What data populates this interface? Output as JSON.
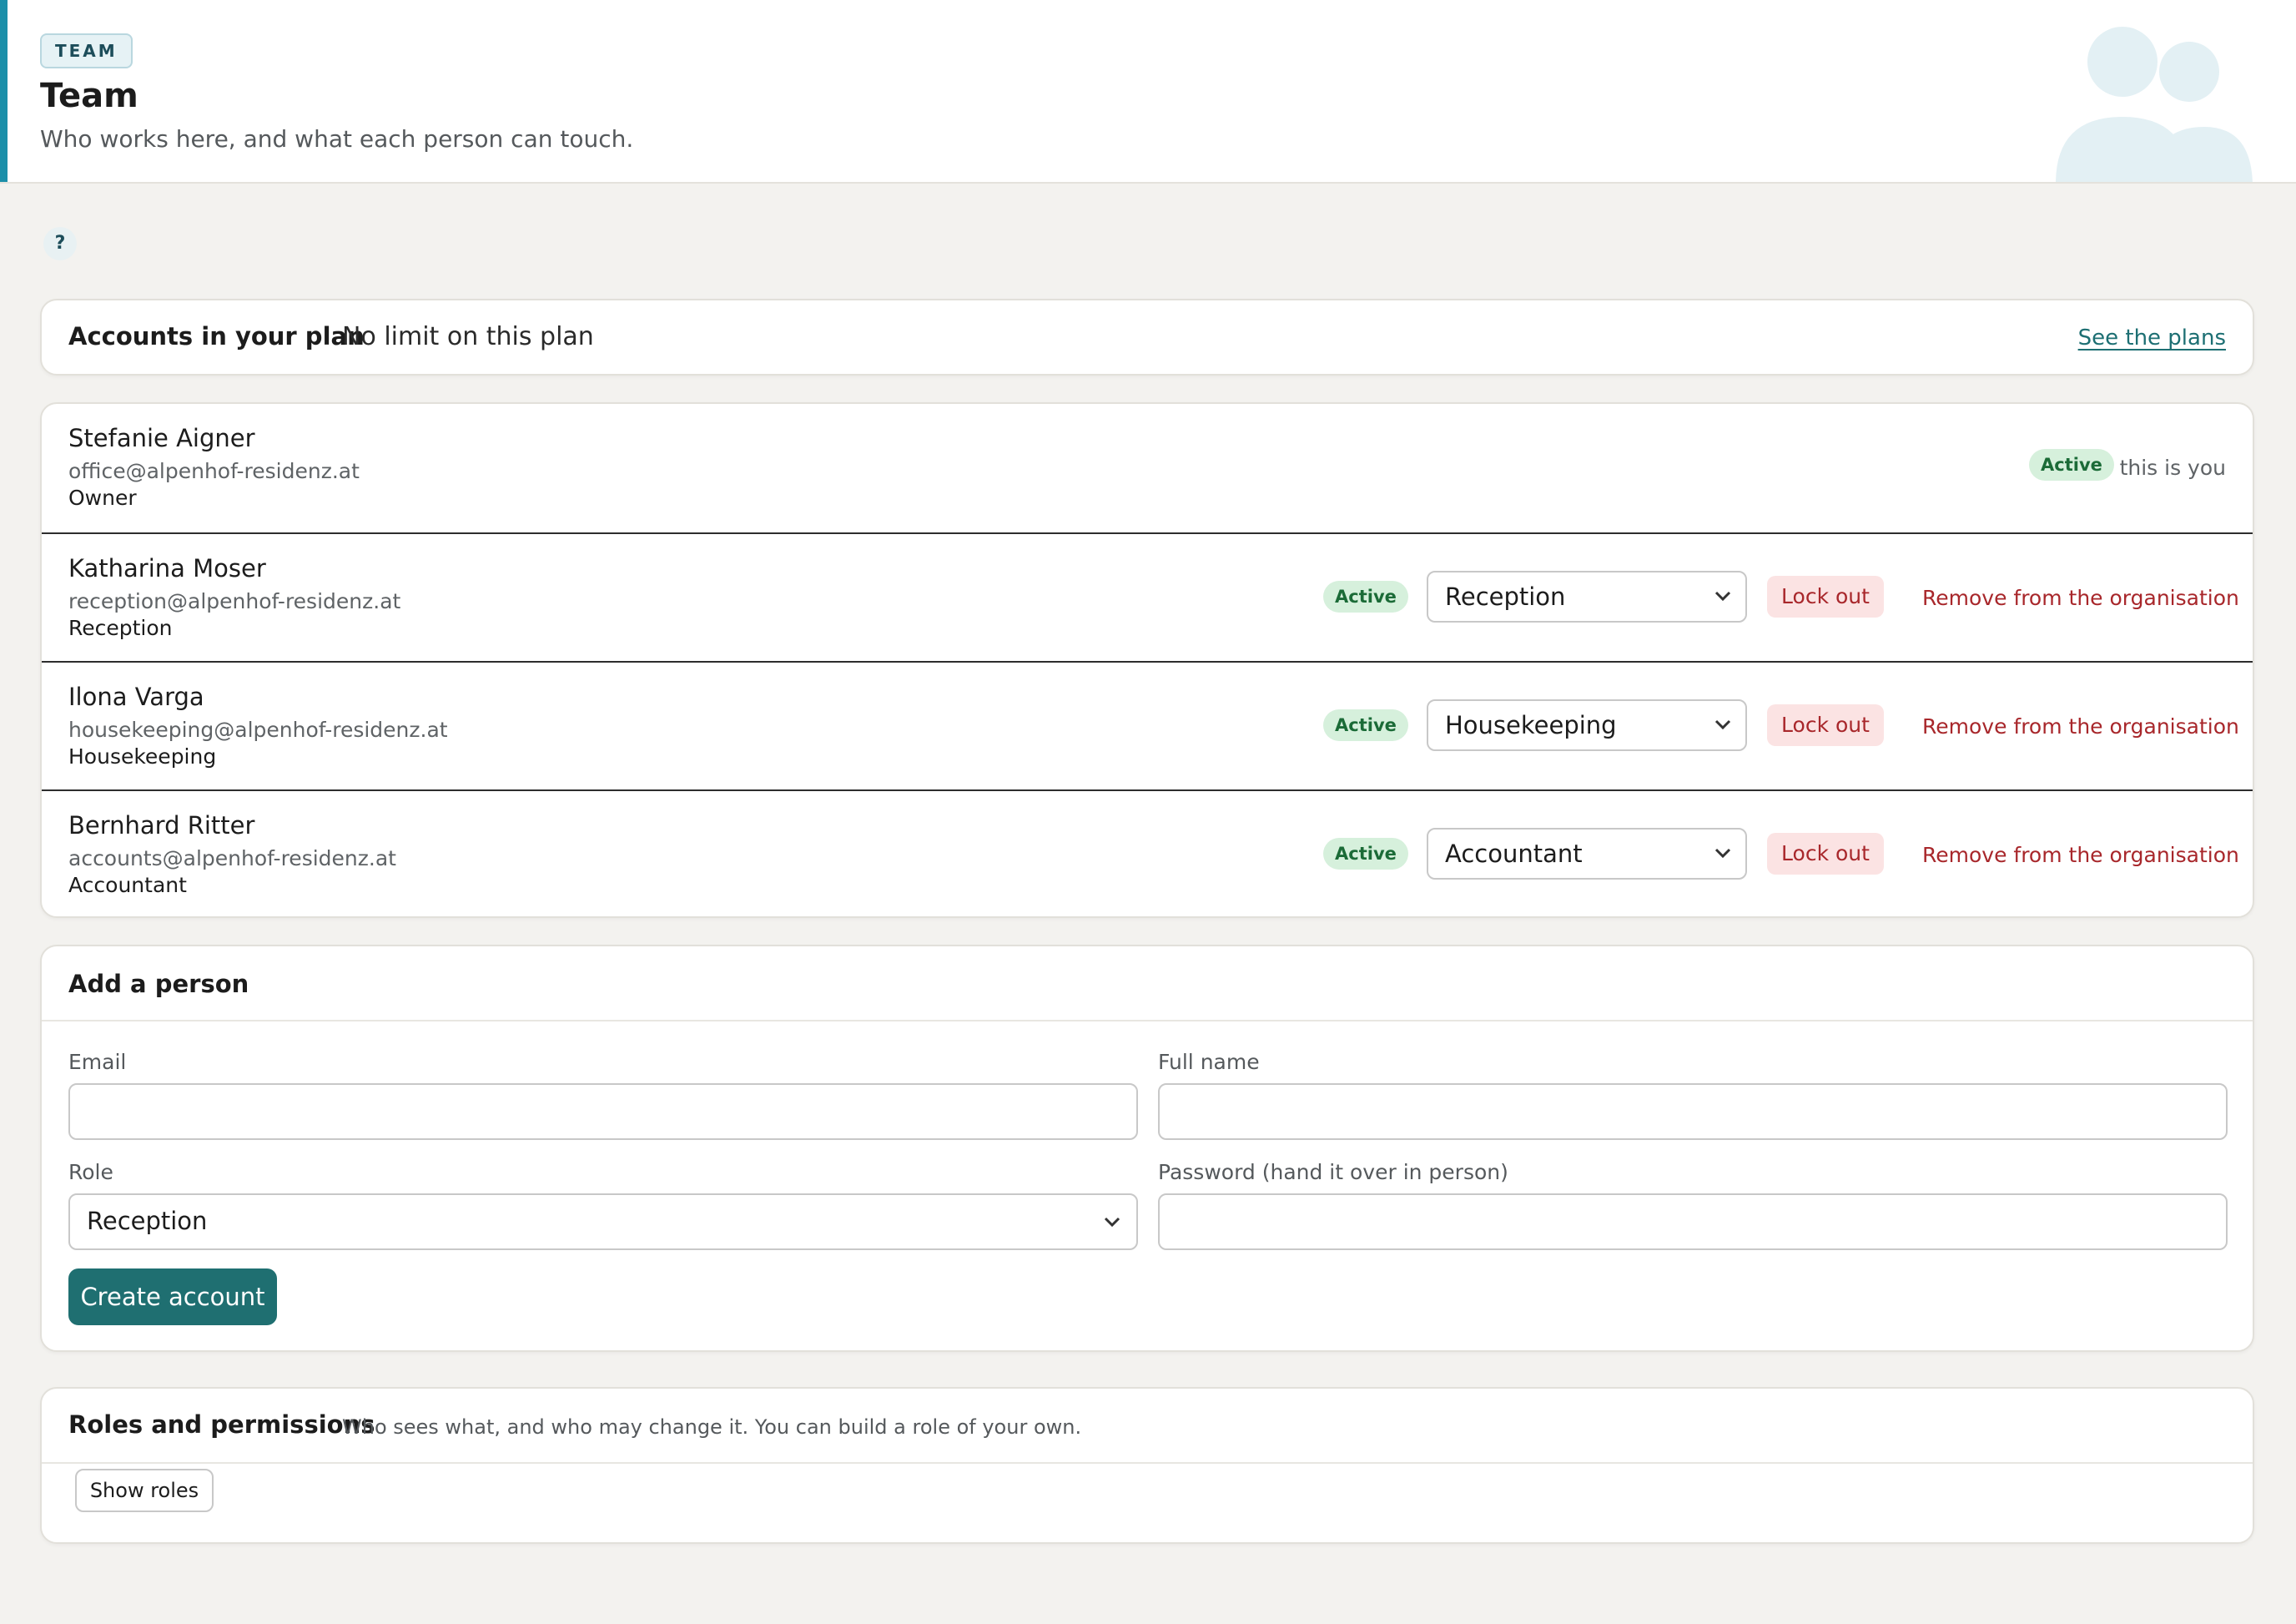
{
  "header": {
    "badge": "TEAM",
    "title": "Team",
    "subtitle": "Who works here, and what each person can touch."
  },
  "help": {
    "label": "?"
  },
  "plan": {
    "label": "Accounts in your plan",
    "value": "No limit on this plan",
    "link": "See the plans"
  },
  "members": [
    {
      "name": "Stefanie Aigner",
      "email": "office@alpenhof-residenz.at",
      "role": "Owner",
      "status": "Active",
      "note": "this is you"
    },
    {
      "name": "Katharina Moser",
      "email": "reception@alpenhof-residenz.at",
      "role": "Reception",
      "status": "Active",
      "select_value": "Reception",
      "lockout": "Lock out",
      "remove": "Remove from the organisation"
    },
    {
      "name": "Ilona Varga",
      "email": "housekeeping@alpenhof-residenz.at",
      "role": "Housekeeping",
      "status": "Active",
      "select_value": "Housekeeping",
      "lockout": "Lock out",
      "remove": "Remove from the organisation"
    },
    {
      "name": "Bernhard Ritter",
      "email": "accounts@alpenhof-residenz.at",
      "role": "Accountant",
      "status": "Active",
      "select_value": "Accountant",
      "lockout": "Lock out",
      "remove": "Remove from the organisation"
    }
  ],
  "add_person": {
    "title": "Add a person",
    "email_label": "Email",
    "email_value": "",
    "fullname_label": "Full name",
    "fullname_value": "",
    "role_label": "Role",
    "role_value": "Reception",
    "password_label": "Password (hand it over in person)",
    "password_value": "",
    "submit": "Create account"
  },
  "roles": {
    "title": "Roles and permissions",
    "subtitle": "Who sees what, and who may change it. You can build a role of your own.",
    "button": "Show roles"
  },
  "colors": {
    "accent": "#1b8fa9",
    "primary_button": "#1f6f71",
    "active_pill_bg": "#d6f0dc",
    "active_pill_text": "#1b6b37",
    "danger_text": "#a8272b",
    "danger_bg": "#fbe3e3"
  }
}
